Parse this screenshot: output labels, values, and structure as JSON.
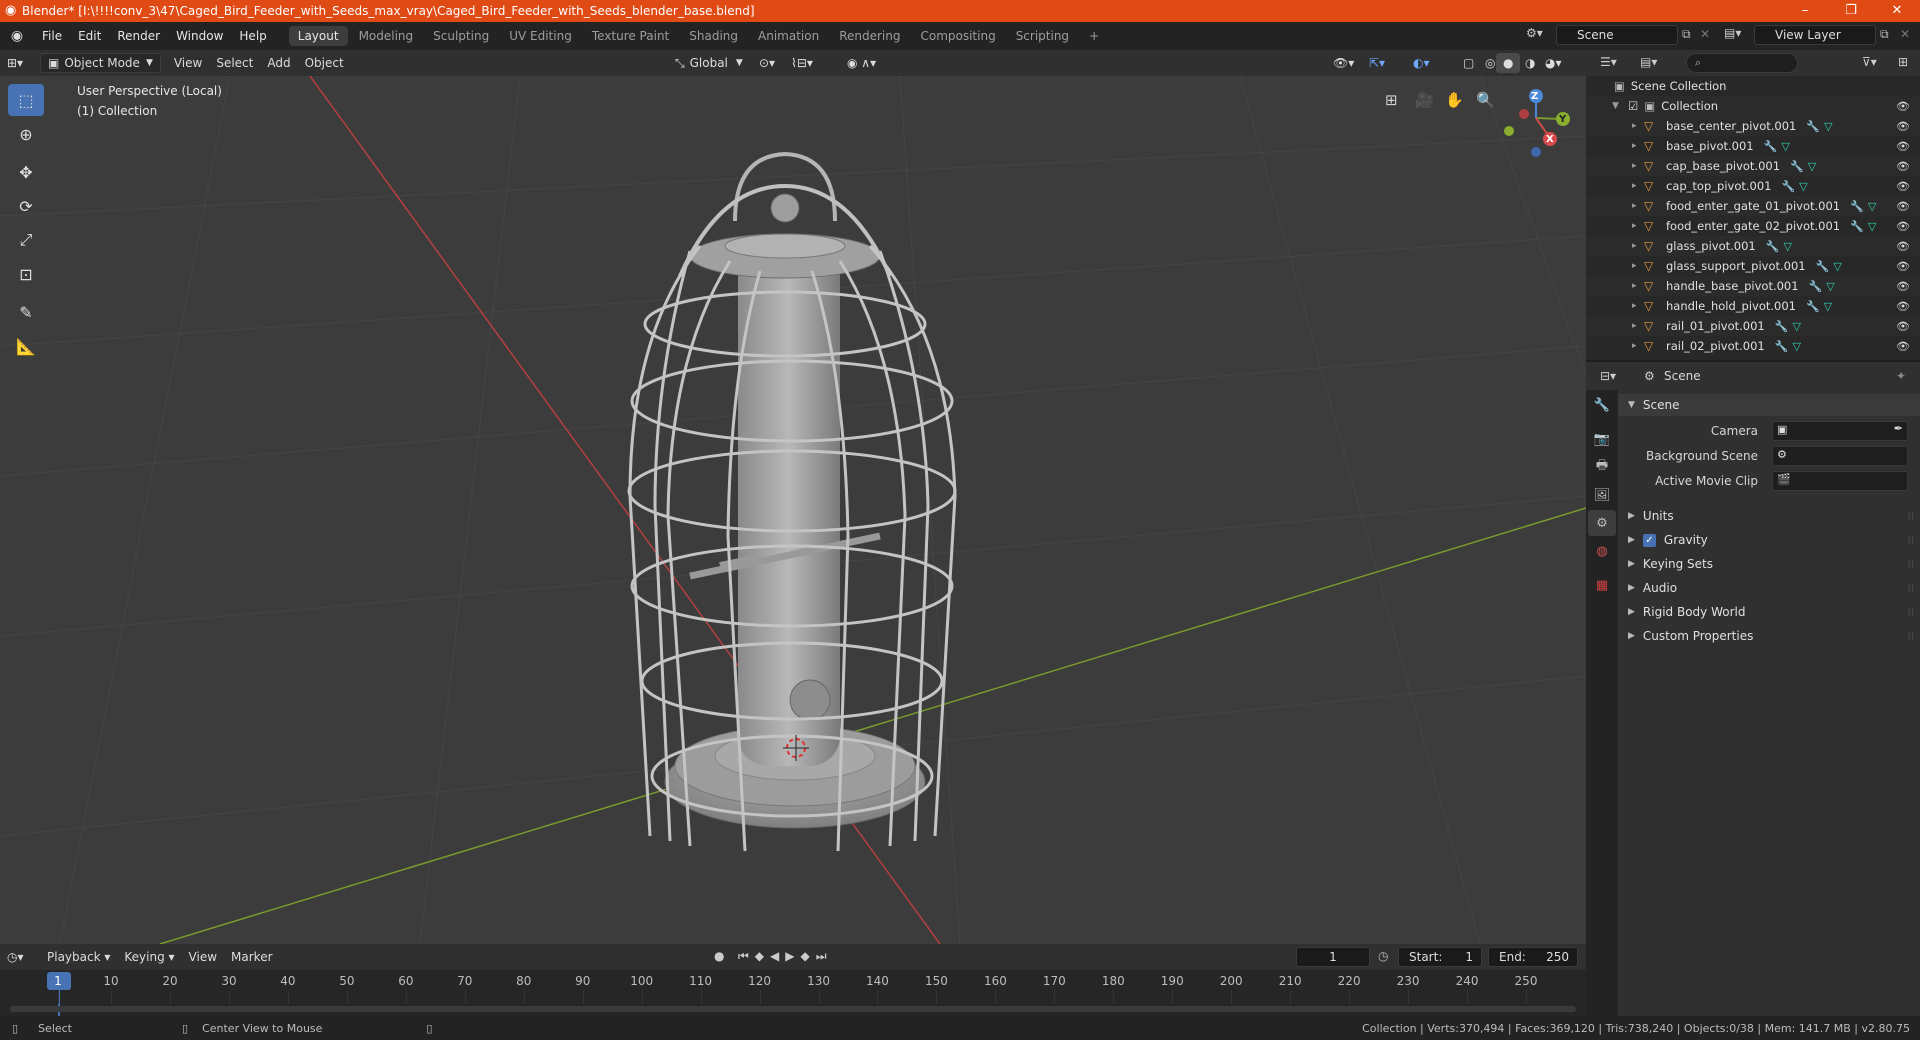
{
  "titlebar": {
    "title": "Blender* [I:\\!!!!conv_3\\47\\Caged_Bird_Feeder_with_Seeds_max_vray\\Caged_Bird_Feeder_with_Seeds_blender_base.blend]",
    "minimize": "–",
    "maximize": "❐",
    "close": "✕"
  },
  "menubar": {
    "items": [
      "File",
      "Edit",
      "Render",
      "Window",
      "Help"
    ],
    "workspaces": [
      "Layout",
      "Modeling",
      "Sculpting",
      "UV Editing",
      "Texture Paint",
      "Shading",
      "Animation",
      "Rendering",
      "Compositing",
      "Scripting"
    ],
    "add_workspace": "+",
    "scene_name": "Scene",
    "view_layer": "View Layer"
  },
  "viewport_header": {
    "mode": "Object Mode",
    "menus": [
      "View",
      "Select",
      "Add",
      "Object"
    ],
    "transform_orientation": "Global"
  },
  "viewport": {
    "perspective_label": "User Perspective (Local)",
    "collection_label": "(1) Collection",
    "gizmo": {
      "x": "X",
      "y": "Y",
      "z": "Z"
    },
    "colors": {
      "background": "#3c3c3c",
      "x_axis": "#b3403f",
      "y_axis": "#7a9a2e",
      "model": "#a0a0a0"
    }
  },
  "outliner": {
    "root": "Scene Collection",
    "collection": "Collection",
    "objects": [
      "base_center_pivot.001",
      "base_pivot.001",
      "cap_base_pivot.001",
      "cap_top_pivot.001",
      "food_enter_gate_01_pivot.001",
      "food_enter_gate_02_pivot.001",
      "glass_pivot.001",
      "glass_support_pivot.001",
      "handle_base_pivot.001",
      "handle_hold_pivot.001",
      "rail_01_pivot.001",
      "rail_02_pivot.001"
    ]
  },
  "properties": {
    "context": "Scene",
    "panel_title": "Scene",
    "fields": [
      {
        "label": "Camera"
      },
      {
        "label": "Background Scene"
      },
      {
        "label": "Active Movie Clip"
      }
    ],
    "subpanels": [
      "Units",
      "Gravity",
      "Keying Sets",
      "Audio",
      "Rigid Body World",
      "Custom Properties"
    ],
    "gravity_checked": true
  },
  "timeline": {
    "menus": [
      "Playback",
      "Keying",
      "View",
      "Marker"
    ],
    "current_frame": "1",
    "start_label": "Start:",
    "start": "1",
    "end_label": "End:",
    "end": "250",
    "ticks": [
      "1",
      "10",
      "20",
      "30",
      "40",
      "50",
      "60",
      "70",
      "80",
      "90",
      "100",
      "110",
      "120",
      "130",
      "140",
      "150",
      "160",
      "170",
      "180",
      "190",
      "200",
      "210",
      "220",
      "230",
      "240",
      "250"
    ]
  },
  "statusbar": {
    "select": "Select",
    "center_view": "Center View to Mouse",
    "stats": "Collection | Verts:370,494 | Faces:369,120 | Tris:738,240 | Objects:0/38 | Mem: 141.7 MB | v2.80.75"
  }
}
